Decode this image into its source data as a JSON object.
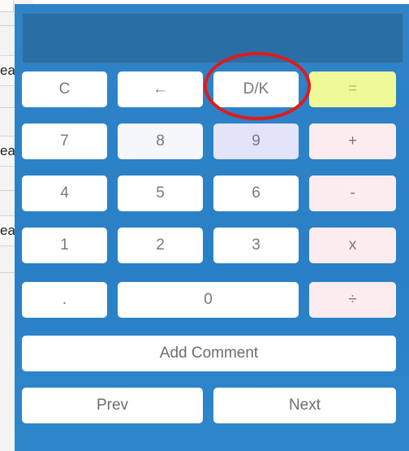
{
  "background_window": {
    "rows": [
      {
        "text": "ea"
      },
      {
        "text": "ea"
      },
      {
        "text": "ea"
      }
    ]
  },
  "calculator": {
    "display": {
      "value": ""
    },
    "keys": {
      "clear": "C",
      "backspace": "←",
      "dk": "D/K",
      "equals": "=",
      "seven": "7",
      "eight": "8",
      "nine": "9",
      "plus": "+",
      "four": "4",
      "five": "5",
      "six": "6",
      "minus": "-",
      "one": "1",
      "two": "2",
      "three": "3",
      "multiply": "x",
      "decimal": ".",
      "zero": "0",
      "divide": "÷",
      "add_comment": "Add Comment",
      "prev": "Prev",
      "next": "Next"
    }
  },
  "annotation": {
    "shape": "ellipse",
    "color": "#e01b1b",
    "highlights": "dk-button"
  }
}
